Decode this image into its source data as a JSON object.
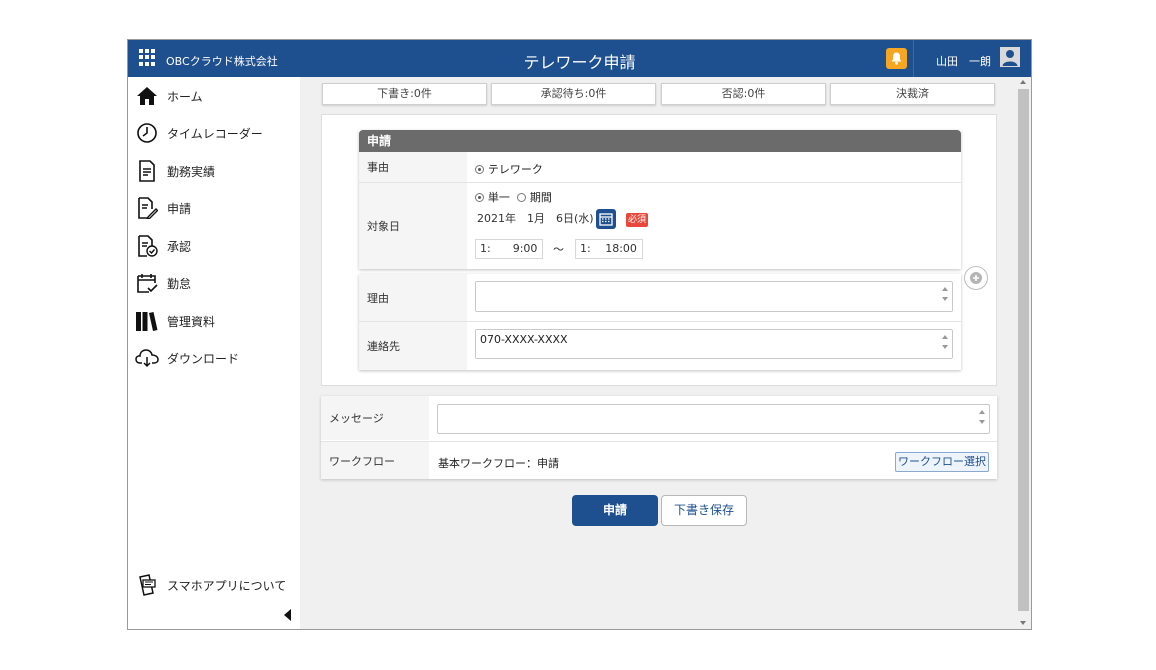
{
  "header": {
    "company": "OBCクラウド株式会社",
    "title": "テレワーク申請",
    "user_name": "山田　一朗"
  },
  "sidebar": {
    "items": [
      {
        "label": "ホーム",
        "icon": "home-icon"
      },
      {
        "label": "タイムレコーダー",
        "icon": "clock-icon"
      },
      {
        "label": "勤務実績",
        "icon": "document-icon"
      },
      {
        "label": "申請",
        "icon": "edit-document-icon"
      },
      {
        "label": "承認",
        "icon": "approve-document-icon"
      },
      {
        "label": "勤怠",
        "icon": "calendar-check-icon"
      },
      {
        "label": "管理資料",
        "icon": "books-icon"
      },
      {
        "label": "ダウンロード",
        "icon": "cloud-download-icon"
      }
    ],
    "mobile_app": "スマホアプリについて"
  },
  "status_tabs": [
    "下書き:0件",
    "承認待ち:0件",
    "否認:0件",
    "決裁済"
  ],
  "form": {
    "section_title": "申請",
    "reason_type_label": "事由",
    "reason_type_value": "テレワーク",
    "target_date_label": "対象日",
    "date_mode_single": "単一",
    "date_mode_period": "期間",
    "date_value": "2021年　1月　6日(水)",
    "required_badge": "必須",
    "time_start": "1:　　9:00",
    "time_separator": "～",
    "time_end": "1:　 18:00",
    "reason_label": "理由",
    "reason_value": "",
    "contact_label": "連絡先",
    "contact_value": "070-XXXX-XXXX"
  },
  "message": {
    "label": "メッセージ",
    "value": "",
    "workflow_label": "ワークフロー",
    "workflow_value": "基本ワークフロー：申請",
    "workflow_button": "ワークフロー選択"
  },
  "actions": {
    "submit": "申請",
    "save_draft": "下書き保存"
  },
  "colors": {
    "header_bg": "#1e4f8f",
    "notification": "#f5a623",
    "required": "#e8483b",
    "section_header": "#6b6b6b"
  }
}
